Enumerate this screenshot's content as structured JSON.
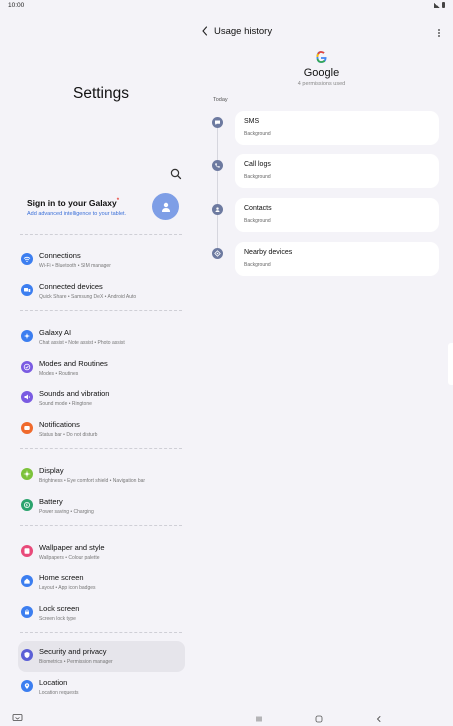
{
  "status_bar": {
    "time": "10:00"
  },
  "settings": {
    "title": "Settings",
    "account": {
      "title": "Sign in to your Galaxy",
      "title_mark": "*",
      "subtitle": "Add advanced intelligence to your tablet."
    },
    "items": [
      {
        "id": "connections",
        "label": "Connections",
        "sub": "Wi-Fi  •  Bluetooth  •  SIM manager",
        "color": "#3c7ef0",
        "icon": "wifi-icon"
      },
      {
        "id": "connected-devices",
        "label": "Connected devices",
        "sub": "Quick Share  •  Samsung DeX  •  Android Auto",
        "color": "#3c7ef0",
        "icon": "devices-icon"
      },
      {
        "id": "galaxy-ai",
        "label": "Galaxy AI",
        "sub": "Chat assist  •  Note assist  •  Photo assist",
        "color": "#3c7ef0",
        "icon": "sparkle-icon"
      },
      {
        "id": "modes-routines",
        "label": "Modes and Routines",
        "sub": "Modes  •  Routines",
        "color": "#7a5be2",
        "icon": "check-circle-icon"
      },
      {
        "id": "sounds",
        "label": "Sounds and vibration",
        "sub": "Sound mode  •  Ringtone",
        "color": "#7a5be2",
        "icon": "speaker-icon"
      },
      {
        "id": "notifications",
        "label": "Notifications",
        "sub": "Status bar  •  Do not disturb",
        "color": "#f06a2c",
        "icon": "bell-icon"
      },
      {
        "id": "display",
        "label": "Display",
        "sub": "Brightness  •  Eye comfort shield  •  Navigation bar",
        "color": "#7cc23a",
        "icon": "sun-icon"
      },
      {
        "id": "battery",
        "label": "Battery",
        "sub": "Power saving  •  Charging",
        "color": "#2ba36d",
        "icon": "battery-icon"
      },
      {
        "id": "wallpaper",
        "label": "Wallpaper and style",
        "sub": "Wallpapers  •  Colour palette",
        "color": "#e84a7a",
        "icon": "image-icon"
      },
      {
        "id": "home-screen",
        "label": "Home screen",
        "sub": "Layout  •  App icon badges",
        "color": "#3c7ef0",
        "icon": "home-icon"
      },
      {
        "id": "lock-screen",
        "label": "Lock screen",
        "sub": "Screen lock type",
        "color": "#3c7ef0",
        "icon": "lock-icon"
      },
      {
        "id": "security",
        "label": "Security and privacy",
        "sub": "Biometrics  •  Permission manager",
        "color": "#5b5fd6",
        "icon": "shield-icon"
      },
      {
        "id": "location",
        "label": "Location",
        "sub": "Location requests",
        "color": "#3c7ef0",
        "icon": "location-pin-icon"
      }
    ]
  },
  "usage": {
    "title": "Usage history",
    "app_name": "Google",
    "permission_count": "4 permissions used",
    "section_label": "Today",
    "entries": [
      {
        "id": "sms",
        "label": "SMS",
        "detail": "Background",
        "icon": "message-icon"
      },
      {
        "id": "call-logs",
        "label": "Call logs",
        "detail": "Background",
        "icon": "phone-log-icon"
      },
      {
        "id": "contacts",
        "label": "Contacts",
        "detail": "Background",
        "icon": "contact-icon"
      },
      {
        "id": "nearby-devices",
        "label": "Nearby devices",
        "detail": "Background",
        "icon": "nearby-icon"
      }
    ]
  },
  "colors": {
    "background": "#f4f3f8",
    "card": "#ffffff",
    "selected": "#e6e5eb",
    "link": "#3a6fd8"
  }
}
